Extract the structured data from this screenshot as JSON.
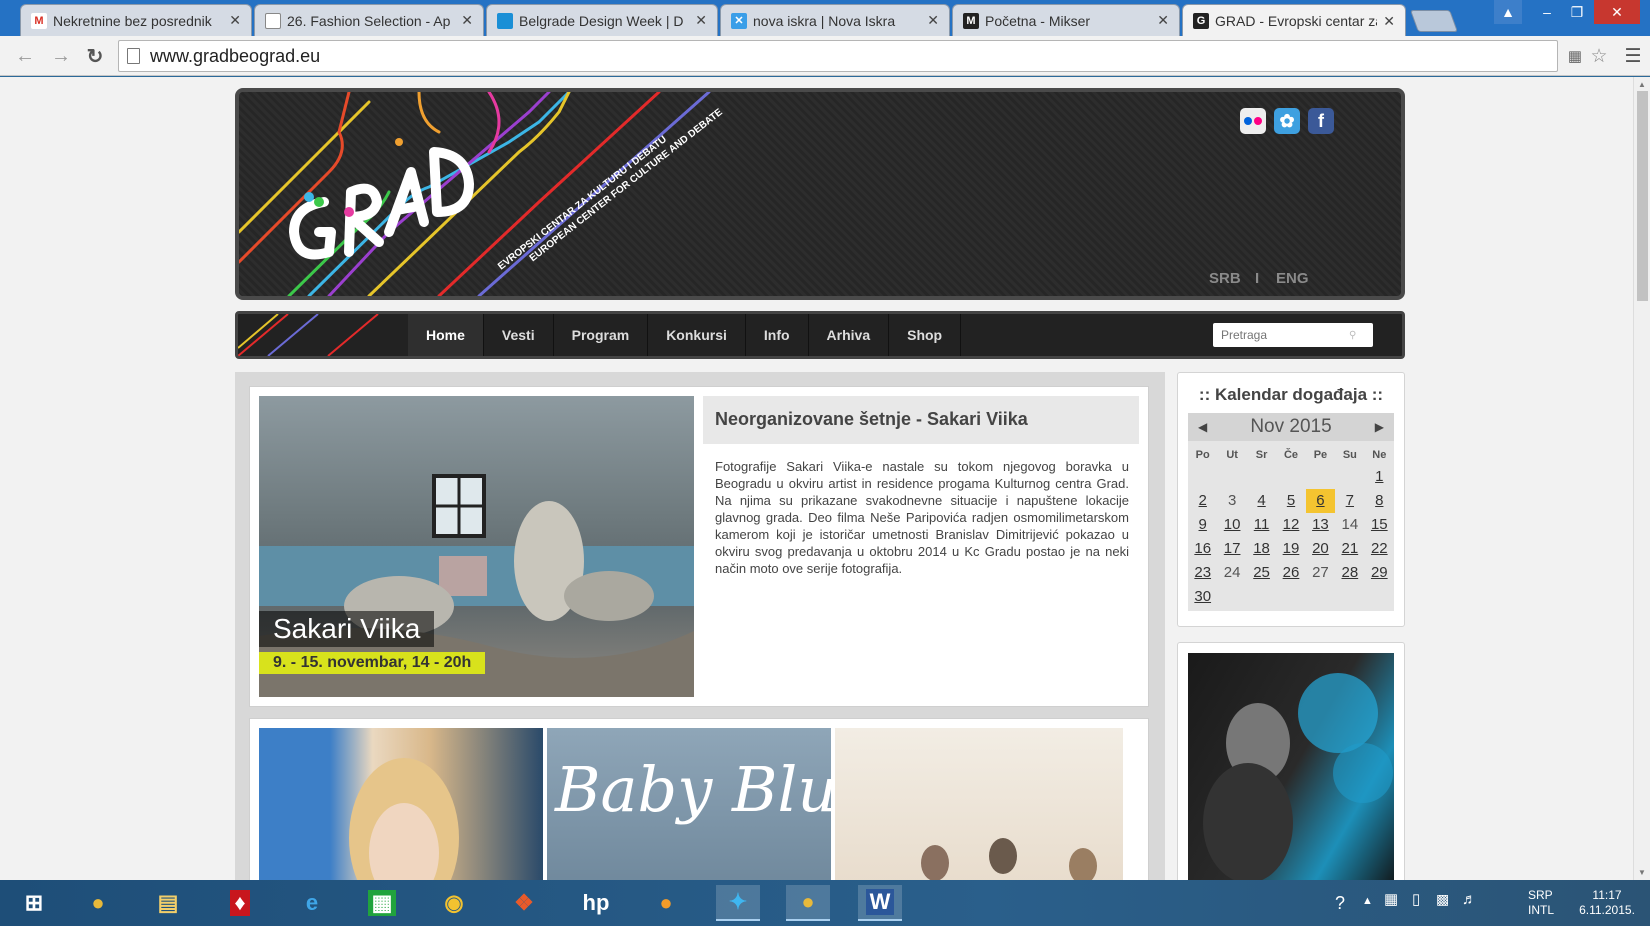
{
  "browser": {
    "tabs": [
      {
        "title": "Nekretnine bez posrednik",
        "favicon": "gmail-icon",
        "fav_color": "#ffffff",
        "fav_text": "M",
        "fav_fg": "#d93025"
      },
      {
        "title": "26. Fashion Selection - Ap",
        "favicon": "page-icon",
        "fav_color": "#ffffff",
        "fav_text": "",
        "fav_fg": "#777"
      },
      {
        "title": "Belgrade Design Week | D",
        "favicon": "bdw-icon",
        "fav_color": "#1a8fd6",
        "fav_text": "",
        "fav_fg": "#fff"
      },
      {
        "title": "nova iskra | Nova Iskra",
        "favicon": "iskra-icon",
        "fav_color": "#3a9ee8",
        "fav_text": "✕",
        "fav_fg": "#fff"
      },
      {
        "title": "Početna - Mikser",
        "favicon": "mikser-icon",
        "fav_color": "#222222",
        "fav_text": "M",
        "fav_fg": "#fff"
      },
      {
        "title": "GRAD - Evropski centar za",
        "favicon": "grad-icon",
        "fav_color": "#222222",
        "fav_text": "G",
        "fav_fg": "#fff"
      }
    ],
    "active_tab": 5,
    "url": "www.gradbeograd.eu"
  },
  "site": {
    "logo_subtitle_1": "EVROPSKI CENTAR ZA KULTURU I DEBATU",
    "logo_subtitle_2": "EUROPEAN CENTER FOR CULTURE AND DEBATE",
    "lang_srb": "SRB",
    "lang_sep": "I",
    "lang_eng": "ENG",
    "nav": [
      "Home",
      "Vesti",
      "Program",
      "Konkursi",
      "Info",
      "Arhiva",
      "Shop"
    ],
    "search_placeholder": "Pretraga"
  },
  "feature": {
    "image_title": "Sakari Viika",
    "image_date": "9. - 15. novembar, 14 - 20h",
    "title": "Neorganizovane šetnje - Sakari Viika",
    "body": "Fotografije Sakari Viika-e nastale su tokom njegovog boravka u Beogradu u okviru artist in residence progama Kulturnog centra Grad. Na njima su prikazane svakodnevne situacije i napuštene lokacije glavnog grada. Deo filma Neše Paripovića radjen osmomilimetarskom kamerom koji je istoričar umetnosti Branislav Dimitrijević pokazao u okviru svog predavanja u oktobru 2014 u Kc Gradu postao je na neki način moto ove serije fotografija."
  },
  "thumbs": {
    "baby_blue": "Baby Blue"
  },
  "calendar": {
    "title": ":: Kalendar događaja ::",
    "month": "Nov 2015",
    "day_names": [
      "Po",
      "Ut",
      "Sr",
      "Če",
      "Pe",
      "Su",
      "Ne"
    ],
    "leading_blanks": 6,
    "days": [
      {
        "d": "1",
        "link": true
      },
      {
        "d": "2",
        "link": true
      },
      {
        "d": "3",
        "link": false
      },
      {
        "d": "4",
        "link": true
      },
      {
        "d": "5",
        "link": true
      },
      {
        "d": "6",
        "link": true,
        "today": true
      },
      {
        "d": "7",
        "link": true
      },
      {
        "d": "8",
        "link": true
      },
      {
        "d": "9",
        "link": true
      },
      {
        "d": "10",
        "link": true
      },
      {
        "d": "11",
        "link": true
      },
      {
        "d": "12",
        "link": true
      },
      {
        "d": "13",
        "link": true
      },
      {
        "d": "14",
        "link": false
      },
      {
        "d": "15",
        "link": true
      },
      {
        "d": "16",
        "link": true
      },
      {
        "d": "17",
        "link": true
      },
      {
        "d": "18",
        "link": true
      },
      {
        "d": "19",
        "link": true
      },
      {
        "d": "20",
        "link": true
      },
      {
        "d": "21",
        "link": true
      },
      {
        "d": "22",
        "link": true
      },
      {
        "d": "23",
        "link": true
      },
      {
        "d": "24",
        "link": false
      },
      {
        "d": "25",
        "link": true
      },
      {
        "d": "26",
        "link": true
      },
      {
        "d": "27",
        "link": false
      },
      {
        "d": "28",
        "link": true
      },
      {
        "d": "29",
        "link": true
      },
      {
        "d": "30",
        "link": true
      }
    ],
    "today_color": "#f4c430"
  },
  "taskbar": {
    "apps": [
      "windows-start-icon",
      "chrome-icon",
      "file-explorer-icon",
      "acrobat-icon",
      "internet-explorer-icon",
      "store-icon",
      "media-player-icon",
      "paint-icon",
      "hp-icon",
      "messenger-icon",
      "telenor-icon",
      "chrome-active-icon",
      "word-icon"
    ],
    "lang": "SRP",
    "layout": "INTL",
    "time": "11:17",
    "date": "6.11.2015."
  }
}
